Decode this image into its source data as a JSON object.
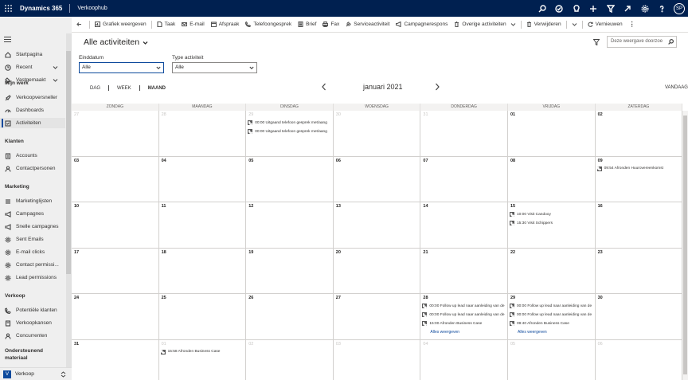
{
  "topbar": {
    "app_name": "Dynamics 365",
    "app_title": "Verkoophub",
    "user_initials": "SP"
  },
  "sidebar": {
    "items_top": [
      {
        "label": "Startpagina",
        "icon": "home-icon"
      },
      {
        "label": "Recent",
        "icon": "clock-icon"
      },
      {
        "label": "Vastgemaakt",
        "icon": "pin-icon"
      }
    ],
    "groups": [
      {
        "title": "Mijn werk",
        "items": [
          "Verkoopversneller",
          "Dashboards",
          "Activiteiten"
        ]
      },
      {
        "title": "Klanten",
        "items": [
          "Accounts",
          "Contactpersonen"
        ]
      },
      {
        "title": "Marketing",
        "items": [
          "Marketinglijsten",
          "Campagnes",
          "Snelle campagnes",
          "Sent Emails",
          "E-mail clicks",
          "Contact permissi...",
          "Lead permissions"
        ]
      },
      {
        "title": "Verkoop",
        "items": [
          "Potentiële klanten",
          "Verkoopkansen",
          "Concurrenten"
        ]
      },
      {
        "title": "Ondersteunend materiaal",
        "items": []
      }
    ],
    "area": {
      "initial": "V",
      "label": "Verkoop"
    }
  },
  "commands": {
    "show_chart": "Grafiek weergeven",
    "task": "Taak",
    "email": "E-mail",
    "appointment": "Afspraak",
    "phone_call": "Telefoongesprek",
    "letter": "Brief",
    "fax": "Fax",
    "service_activity": "Serviceactiviteit",
    "campaign_response": "Campagnerespons",
    "other_activities": "Overige activiteiten",
    "delete": "Verwijderen",
    "refresh": "Vernieuwen"
  },
  "view": {
    "title": "Alle activiteiten",
    "search_placeholder": "Deze weergave doorzoe",
    "filter1": {
      "label": "Einddatum",
      "value": "Alle"
    },
    "filter2": {
      "label": "Type activiteit",
      "value": "Alle"
    },
    "modes": [
      "DAG",
      "WEEK",
      "MAAND"
    ],
    "selected_mode": "MAAND",
    "month": "januari 2021",
    "today": "VANDAAG"
  },
  "calendar": {
    "weekdays": [
      "ZONDAG",
      "MAANDAG",
      "DINSDAG",
      "WOENSDAG",
      "DONDERDAG",
      "VRIJDAG",
      "ZATERDAG"
    ],
    "weeks": [
      [
        {
          "day": "27",
          "other": true,
          "events": []
        },
        {
          "day": "28",
          "other": true,
          "events": []
        },
        {
          "day": "29",
          "other": true,
          "events": [
            "00:00 Uitgaand telefoon gesprek met/aang",
            "00:00 Uitgaand telefoon gesprek met/aang"
          ]
        },
        {
          "day": "30",
          "other": true,
          "events": []
        },
        {
          "day": "31",
          "other": true,
          "events": []
        },
        {
          "day": "01",
          "other": false,
          "events": []
        },
        {
          "day": "02",
          "other": false,
          "events": []
        }
      ],
      [
        {
          "day": "03",
          "other": false,
          "events": []
        },
        {
          "day": "04",
          "other": false,
          "events": []
        },
        {
          "day": "05",
          "other": false,
          "events": []
        },
        {
          "day": "06",
          "other": false,
          "events": []
        },
        {
          "day": "07",
          "other": false,
          "events": []
        },
        {
          "day": "08",
          "other": false,
          "events": []
        },
        {
          "day": "09",
          "other": false,
          "events": [
            "09:54 Afronden Huurovereenkomst"
          ]
        }
      ],
      [
        {
          "day": "10",
          "other": false,
          "events": []
        },
        {
          "day": "11",
          "other": false,
          "events": []
        },
        {
          "day": "12",
          "other": false,
          "events": []
        },
        {
          "day": "13",
          "other": false,
          "events": []
        },
        {
          "day": "14",
          "other": false,
          "events": []
        },
        {
          "day": "15",
          "other": false,
          "events": [
            "10:00 Visit Candooy",
            "15:30 Visit Schippers"
          ]
        },
        {
          "day": "16",
          "other": false,
          "events": []
        }
      ],
      [
        {
          "day": "17",
          "other": false,
          "events": []
        },
        {
          "day": "18",
          "other": false,
          "events": []
        },
        {
          "day": "19",
          "other": false,
          "events": []
        },
        {
          "day": "20",
          "other": false,
          "events": []
        },
        {
          "day": "21",
          "other": false,
          "events": []
        },
        {
          "day": "22",
          "other": false,
          "events": []
        },
        {
          "day": "23",
          "other": false,
          "events": []
        }
      ],
      [
        {
          "day": "24",
          "other": false,
          "events": []
        },
        {
          "day": "25",
          "other": false,
          "events": []
        },
        {
          "day": "26",
          "other": false,
          "events": []
        },
        {
          "day": "27",
          "other": false,
          "events": []
        },
        {
          "day": "28",
          "other": false,
          "events": [
            "00:00 Follow up lead naar aanleiding van de",
            "00:00 Follow up lead naar aanleiding van de",
            "15:00 Afronden Business Case"
          ],
          "see_all": "Alles weergeven"
        },
        {
          "day": "29",
          "other": false,
          "events": [
            "00:00 Follow up lead naar aanleiding van de",
            "00:00 Follow up lead naar aanleiding van de",
            "09:40 Afronden Business Case"
          ],
          "see_all": "Alles weergeven"
        },
        {
          "day": "30",
          "other": false,
          "events": []
        }
      ],
      [
        {
          "day": "31",
          "other": false,
          "events": []
        },
        {
          "day": "01",
          "other": true,
          "events": [
            "15:58 Afronden Business Case"
          ]
        },
        {
          "day": "02",
          "other": true,
          "events": []
        },
        {
          "day": "03",
          "other": true,
          "events": []
        },
        {
          "day": "04",
          "other": true,
          "events": []
        },
        {
          "day": "05",
          "other": true,
          "events": []
        },
        {
          "day": "06",
          "other": true,
          "events": []
        }
      ]
    ]
  },
  "colors": {
    "topbar": "#002050",
    "accent": "#0e4a9c"
  }
}
